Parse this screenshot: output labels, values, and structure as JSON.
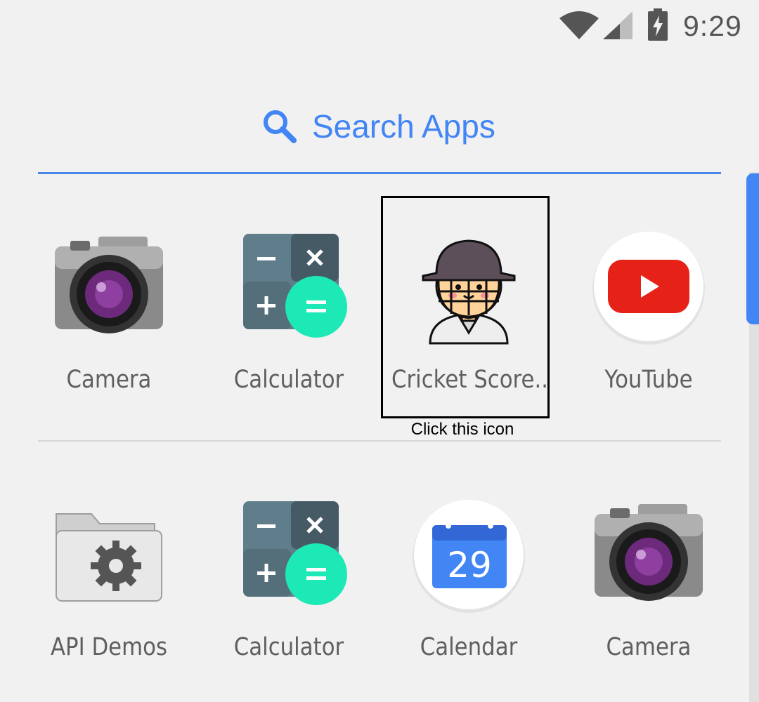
{
  "status_bar": {
    "time": "9:29"
  },
  "search": {
    "label": "Search Apps"
  },
  "apps_row1": [
    {
      "label": "Camera",
      "icon": "camera-icon"
    },
    {
      "label": "Calculator",
      "icon": "calculator-icon"
    },
    {
      "label": "Cricket Score..",
      "icon": "cricket-player-icon"
    },
    {
      "label": "YouTube",
      "icon": "youtube-icon"
    }
  ],
  "apps_row2": [
    {
      "label": "API Demos",
      "icon": "folder-gear-icon"
    },
    {
      "label": "Calculator",
      "icon": "calculator-icon"
    },
    {
      "label": "Calendar",
      "icon": "calendar-icon",
      "date": "29"
    },
    {
      "label": "Camera",
      "icon": "camera-icon"
    }
  ],
  "annotation": {
    "hint": "Click this icon"
  },
  "colors": {
    "accent": "#4285f4",
    "youtube_red": "#e62117",
    "calc_green": "#1de9b6",
    "calendar_blue": "#3367d6"
  }
}
